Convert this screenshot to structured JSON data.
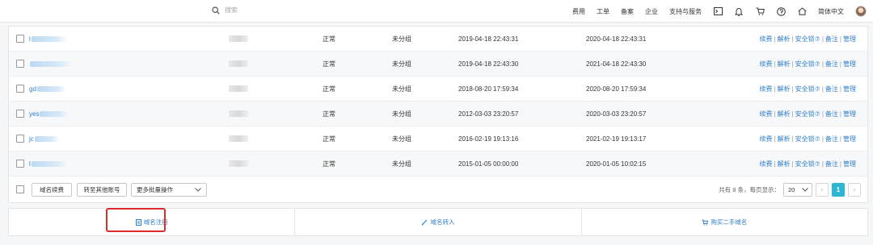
{
  "topbar": {
    "search_placeholder": "搜索",
    "nav": [
      "费用",
      "工单",
      "备案",
      "企业",
      "支持与服务"
    ],
    "icons": [
      "terminal-icon",
      "bell-icon",
      "cart-icon",
      "help-icon",
      "home-icon"
    ],
    "language": "简体中文"
  },
  "table": {
    "rows": [
      {
        "name": "l",
        "status": "正常",
        "group": "未分组",
        "registered": "2019-04-18 22:43:31",
        "expires": "2020-04-18 22:43:31",
        "ops": [
          "续费",
          "解析",
          "安全锁⑦",
          "备注",
          "管理"
        ]
      },
      {
        "name": "",
        "status": "正常",
        "group": "未分组",
        "registered": "2019-04-18 22:43:30",
        "expires": "2021-04-18 22:43:30",
        "ops": [
          "续费",
          "解析",
          "安全锁⑦",
          "备注",
          "管理"
        ]
      },
      {
        "name": "gd",
        "status": "正常",
        "group": "未分组",
        "registered": "2018-08-20 17:59:34",
        "expires": "2020-08-20 17:59:34",
        "ops": [
          "续费",
          "解析",
          "安全锁⑦",
          "备注",
          "管理"
        ]
      },
      {
        "name": "yes",
        "status": "正常",
        "group": "未分组",
        "registered": "2012-03-03 23:20:57",
        "expires": "2020-03-03 23:20:57",
        "ops": [
          "续费",
          "解析",
          "安全锁⑦",
          "备注",
          "管理"
        ]
      },
      {
        "name": "jc",
        "status": "正常",
        "group": "未分组",
        "registered": "2016-02-19 19:13:16",
        "expires": "2021-02-19 19:13:17",
        "ops": [
          "续费",
          "解析",
          "安全锁⑦",
          "备注",
          "管理"
        ]
      },
      {
        "name": "l",
        "status": "正常",
        "group": "未分组",
        "registered": "2015-01-05 00:00:00",
        "expires": "2020-01-05 10:02:15",
        "ops": [
          "续费",
          "解析",
          "安全锁⑦",
          "备注",
          "管理"
        ]
      }
    ],
    "batch": {
      "renew_button": "域名续费",
      "transfer_button": "转至其他账号",
      "more_select": "更多批量操作"
    },
    "pager": {
      "summary": "共有 8 条，每页显示：",
      "page_size": "20",
      "prev": "‹",
      "current": "1",
      "next": "›"
    }
  },
  "actions": {
    "register": "域名注册",
    "transfer_in": "域名转入",
    "buy_used": "购买二手域名"
  },
  "colors": {
    "link": "#2f7ecb",
    "pager_active": "#2db7d5",
    "highlight": "#e02b2b"
  }
}
